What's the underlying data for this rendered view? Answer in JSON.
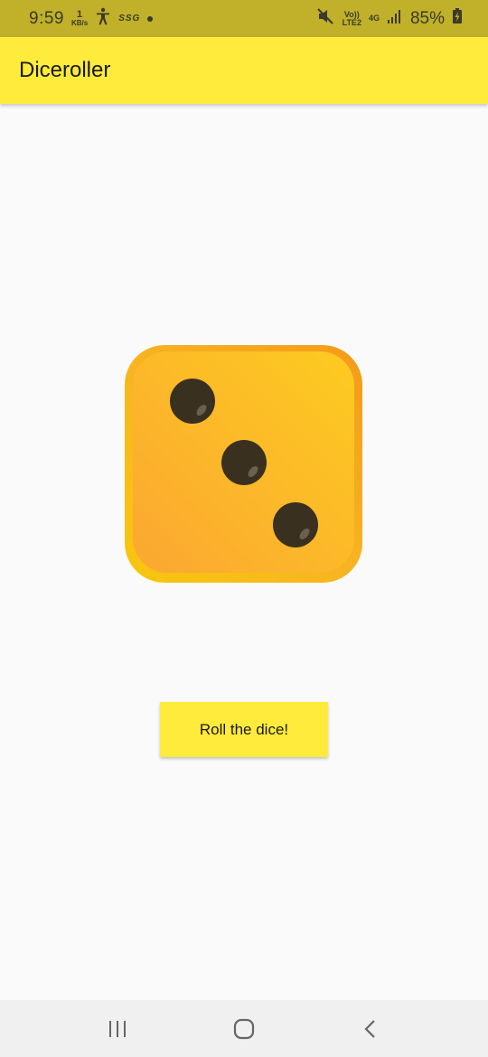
{
  "status_bar": {
    "time": "9:59",
    "net_speed_value": "1",
    "net_speed_unit": "KB/s",
    "carrier_tag": "SSG",
    "volte": "Vo))",
    "lte": "LTE2",
    "network_type": "4G",
    "battery_percent": "85%",
    "icons": [
      "accessibility-icon",
      "mute-icon",
      "signal-icon",
      "battery-charging-icon"
    ]
  },
  "app_bar": {
    "title": "Diceroller"
  },
  "dice": {
    "face_value": 3,
    "colors": {
      "fill": "#fbb431",
      "edge": "#f5a623",
      "pip": "#3a3020"
    }
  },
  "roll_button": {
    "label": "Roll the dice!"
  },
  "nav_bar": {
    "buttons": [
      "recent-apps-icon",
      "home-icon",
      "back-icon"
    ]
  },
  "colors": {
    "status_bar": "#c0b02a",
    "app_bar": "#ffeb3b",
    "background": "#fafafa",
    "button": "#ffeb3b"
  }
}
